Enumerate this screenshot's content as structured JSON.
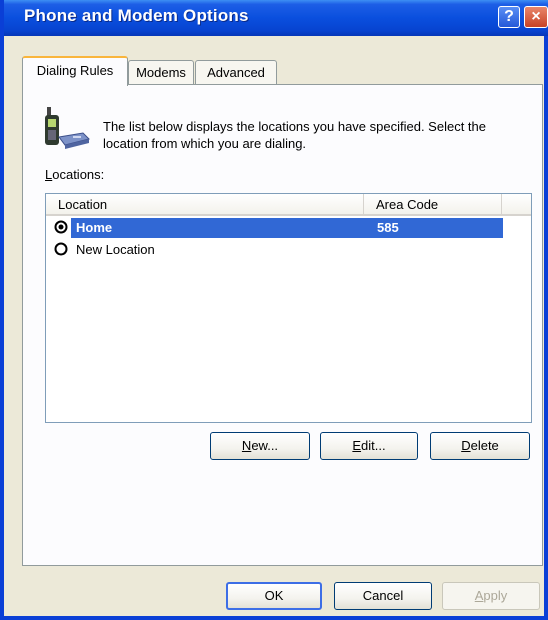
{
  "window": {
    "title": "Phone and Modem Options",
    "help_label": "?",
    "close_label": "×"
  },
  "tabs": [
    {
      "label": "Dialing Rules"
    },
    {
      "label": "Modems"
    },
    {
      "label": "Advanced"
    }
  ],
  "main": {
    "description": "The list below displays the locations you have specified. Select the location from which you are dialing.",
    "locations_label_mnemonic": "L",
    "locations_label_rest": "ocations:",
    "columns": [
      "Location",
      "Area Code"
    ],
    "rows": [
      {
        "location": "Home",
        "area_code": "585",
        "selected": true
      },
      {
        "location": "New Location",
        "area_code": "",
        "selected": false
      }
    ],
    "buttons": {
      "new_mnemonic": "N",
      "new_rest": "ew...",
      "edit_mnemonic": "E",
      "edit_rest": "dit...",
      "delete_mnemonic": "D",
      "delete_rest": "elete"
    }
  },
  "footer": {
    "ok_label": "OK",
    "cancel_label": "Cancel",
    "apply_mnemonic": "A",
    "apply_rest": "pply"
  },
  "colors": {
    "titlebar": "#0a4fde",
    "selection": "#3168d5",
    "tab_highlight": "#f9b53c",
    "dialog_bg": "#ece9d8"
  },
  "icons": [
    "phone-modem-icon",
    "help-icon",
    "close-icon",
    "radio-checked-icon",
    "radio-unchecked-icon"
  ]
}
